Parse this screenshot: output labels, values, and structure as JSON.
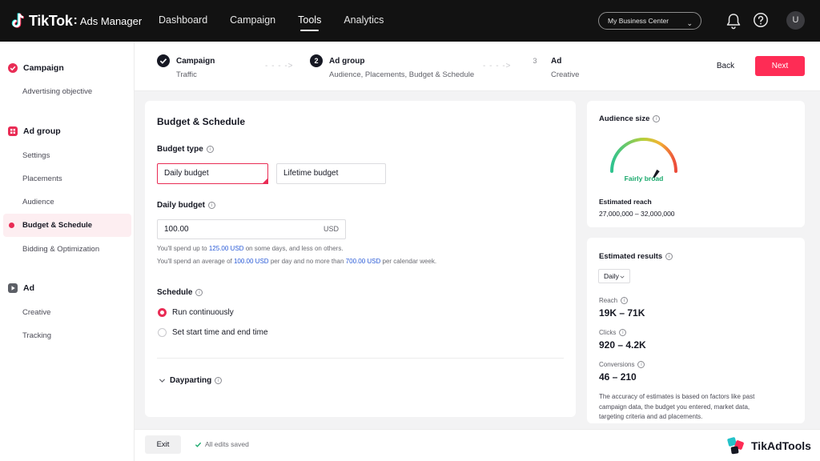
{
  "app": {
    "brand": "TikTok",
    "colon": ":",
    "product": "Ads Manager",
    "nav": [
      "Dashboard",
      "Campaign",
      "Tools",
      "Analytics"
    ],
    "active_nav": "Tools",
    "business_center": "My Business Center",
    "user_initial": "U"
  },
  "sidebar": {
    "campaign": {
      "label": "Campaign",
      "items": [
        "Advertising objective"
      ]
    },
    "ad_group": {
      "label": "Ad group",
      "items": [
        "Settings",
        "Placements",
        "Audience",
        "Budget & Schedule",
        "Bidding & Optimization"
      ]
    },
    "ad": {
      "label": "Ad",
      "items": [
        "Creative",
        "Tracking"
      ]
    },
    "active_item": "Budget & Schedule"
  },
  "stepper": {
    "steps": [
      {
        "title": "Campaign",
        "subtitle": "Traffic",
        "marker": ""
      },
      {
        "title": "Ad group",
        "subtitle": "Audience, Placements, Budget & Schedule",
        "marker": "2"
      },
      {
        "title": "Ad",
        "subtitle": "Creative",
        "marker": "3"
      }
    ],
    "arrow": "- - - ->",
    "back_label": "Back",
    "next_label": "Next"
  },
  "budget": {
    "title": "Budget & Schedule",
    "budget_type_label": "Budget type",
    "options": [
      "Daily budget",
      "Lifetime budget"
    ],
    "selected_option": "Daily budget",
    "daily_budget_label": "Daily budget",
    "daily_budget_value": "100.00",
    "currency": "USD",
    "hint1_pre": "You'll spend up to",
    "hint1_amount": "125.00 USD",
    "hint1_post": "on some days, and less on others.",
    "hint2_pre": "You'll spend an average of",
    "hint2_amount1": "100.00 USD",
    "hint2_mid": "per day and no more than",
    "hint2_amount2": "700.00 USD",
    "hint2_post": "per calendar week.",
    "schedule_label": "Schedule",
    "schedule_options": [
      "Run continuously",
      "Set start time and end time"
    ],
    "selected_schedule": "Run continuously",
    "dayparting_label": "Dayparting"
  },
  "audience": {
    "title": "Audience size",
    "gauge_label": "Fairly broad",
    "gauge_level": 0.68,
    "estimated_reach_label": "Estimated reach",
    "estimated_reach_value": "27,000,000 – 32,000,000"
  },
  "results": {
    "title": "Estimated results",
    "period": "Daily",
    "metrics": [
      {
        "label": "Reach",
        "value": "19K – 71K"
      },
      {
        "label": "Clicks",
        "value": "920 – 4.2K"
      },
      {
        "label": "Conversions",
        "value": "46 – 210"
      }
    ],
    "note": "The accuracy of estimates is based on factors like past campaign data, the budget you entered, market data, targeting criteria and ad placements."
  },
  "footer": {
    "exit_label": "Exit",
    "saved_text": "All edits saved"
  },
  "watermark": {
    "text": "TikAdTools"
  },
  "colors": {
    "accent": "#fe2c55",
    "link": "#2a5bd7",
    "gauge_label": "#1aa96c"
  }
}
